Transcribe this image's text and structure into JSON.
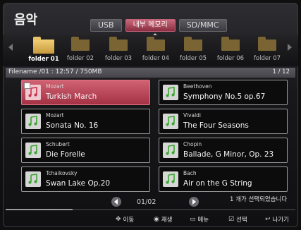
{
  "header": {
    "title": "음악"
  },
  "tabs": [
    {
      "label": "USB"
    },
    {
      "label": "내부 메모리"
    },
    {
      "label": "SD/MMC"
    }
  ],
  "folders": [
    {
      "label": "folder 01"
    },
    {
      "label": "folder 02"
    },
    {
      "label": "folder 03"
    },
    {
      "label": "folder 04"
    },
    {
      "label": "folder 05"
    },
    {
      "label": "folder 06"
    },
    {
      "label": "folder 07"
    }
  ],
  "infobar": {
    "filename": "Filename /01 : 12:57 / 750MB",
    "page": "1 / 12"
  },
  "songs": [
    {
      "artist": "Mozart",
      "title": "Turkish March"
    },
    {
      "artist": "Beethoven",
      "title": "Symphony No.5 op.67"
    },
    {
      "artist": "Mozart",
      "title": "Sonata No. 16"
    },
    {
      "artist": "Vivaldi",
      "title": "The Four Seasons"
    },
    {
      "artist": "Schubert",
      "title": "Die Forelle"
    },
    {
      "artist": "Chopin",
      "title": "Ballade, G Minor, Op. 23"
    },
    {
      "artist": "Tchaikovsky",
      "title": "Swan Lake Op.20"
    },
    {
      "artist": "Bach",
      "title": "Air on the G String"
    }
  ],
  "pager": {
    "page": "01/02"
  },
  "selection_info": "1 개가 선택되었습니다",
  "progress": 0.23,
  "footer": {
    "move": "이동",
    "play": "재생",
    "menu": "메뉴",
    "select": "선택",
    "exit": "나가기"
  },
  "colors": {
    "accent": "#b43a50",
    "folder": "#e8c266"
  }
}
